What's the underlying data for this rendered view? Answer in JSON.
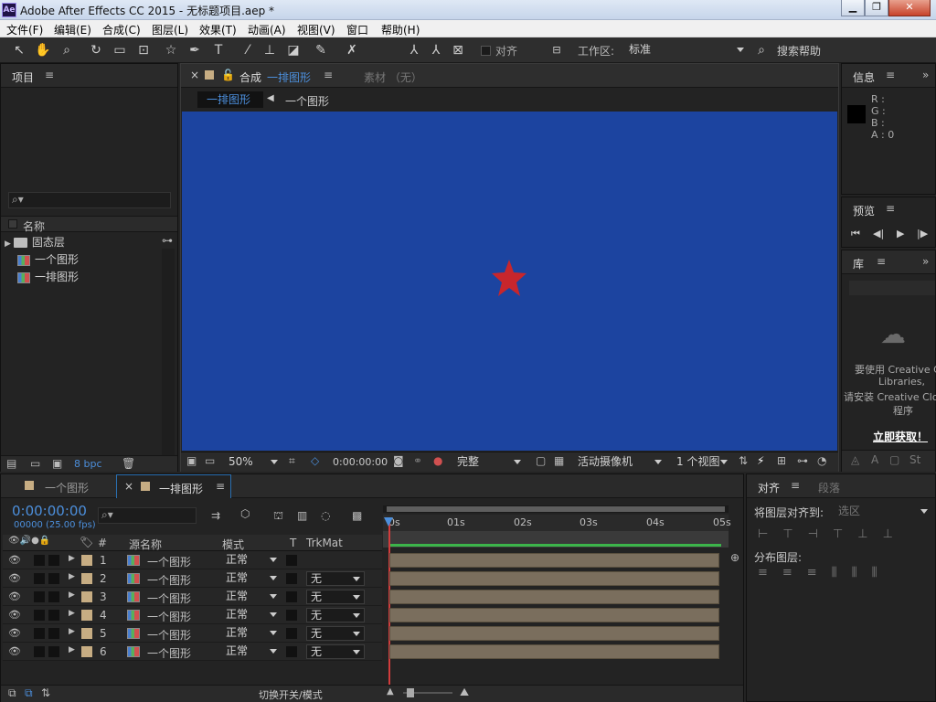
{
  "window": {
    "title": "Adobe After Effects CC 2015 - 无标题项目.aep *",
    "logo": "Ae"
  },
  "menu": [
    "文件(F)",
    "编辑(E)",
    "合成(C)",
    "图层(L)",
    "效果(T)",
    "动画(A)",
    "视图(V)",
    "窗口",
    "帮助(H)"
  ],
  "toolbar": {
    "snap_label": "对齐",
    "workspace_label": "工作区:",
    "workspace_value": "标准",
    "search_help": "搜索帮助"
  },
  "project": {
    "title": "项目",
    "column_name": "名称",
    "items": [
      {
        "name": "固态层",
        "type": "folder"
      },
      {
        "name": "一个图形",
        "type": "comp"
      },
      {
        "name": "一排图形",
        "type": "comp"
      }
    ],
    "bpc": "8 bpc"
  },
  "composition": {
    "tab_label": "合成",
    "tab_name": "一排图形",
    "footage_tab": "素材 （无）",
    "breadcrumb": [
      "一排图形",
      "一个图形"
    ],
    "canvas_color": "#1c44a0",
    "star_color": "#c8262c",
    "zoom": "50%",
    "timecode": "0:00:00:00",
    "resolution": "完整",
    "camera": "活动摄像机",
    "views": "1 个视图"
  },
  "info": {
    "title": "信息",
    "r": "R :",
    "g": "G :",
    "b": "B :",
    "a": "A : 0"
  },
  "preview": {
    "title": "预览"
  },
  "library": {
    "title": "库",
    "msg1": "要使用 Creative Cl",
    "msg2": "Libraries,",
    "msg3": "请安装 Creative Clou",
    "msg4": "程序",
    "install": "立即获取！"
  },
  "timeline": {
    "tabs": [
      "一个图形",
      "一排图形"
    ],
    "timecode": "0:00:00:00",
    "fps": "00000 (25.00 fps)",
    "col_source": "源名称",
    "col_mode": "模式",
    "col_t": "T",
    "col_trkmat": "TrkMat",
    "ruler": [
      "0s",
      "01s",
      "02s",
      "03s",
      "04s",
      "05s"
    ],
    "layers": [
      {
        "num": "1",
        "name": "一个图形",
        "mode": "正常",
        "trkmat": ""
      },
      {
        "num": "2",
        "name": "一个图形",
        "mode": "正常",
        "trkmat": "无"
      },
      {
        "num": "3",
        "name": "一个图形",
        "mode": "正常",
        "trkmat": "无"
      },
      {
        "num": "4",
        "name": "一个图形",
        "mode": "正常",
        "trkmat": "无"
      },
      {
        "num": "5",
        "name": "一个图形",
        "mode": "正常",
        "trkmat": "无"
      },
      {
        "num": "6",
        "name": "一个图形",
        "mode": "正常",
        "trkmat": "无"
      }
    ],
    "footer": "切换开关/模式"
  },
  "align": {
    "title": "对齐",
    "paragraph_tab": "段落",
    "align_to_label": "将图层对齐到:",
    "align_to_value": "选区",
    "distribute_label": "分布图层:"
  }
}
